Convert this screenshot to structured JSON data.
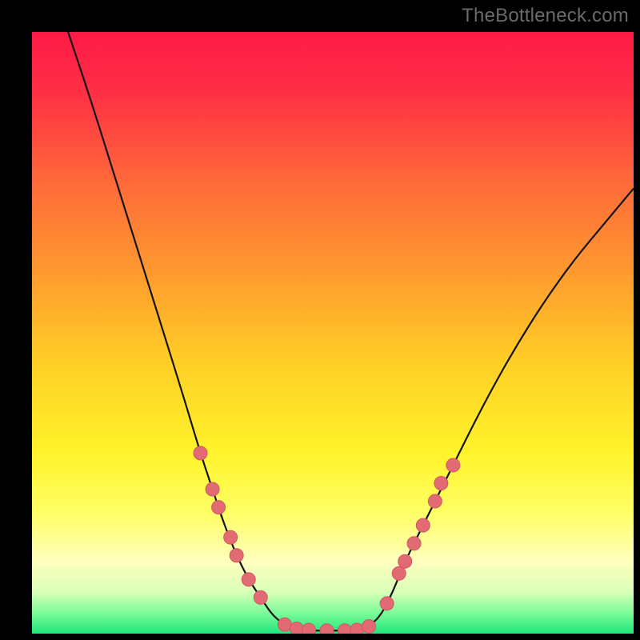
{
  "watermark": {
    "text": "TheBottleneck.com"
  },
  "palette": {
    "black": "#000000",
    "gradient_stops": [
      {
        "offset": 0.0,
        "color": "#ff1a46"
      },
      {
        "offset": 0.1,
        "color": "#ff2f45"
      },
      {
        "offset": 0.25,
        "color": "#ff6a3a"
      },
      {
        "offset": 0.4,
        "color": "#ff9a2f"
      },
      {
        "offset": 0.55,
        "color": "#ffcf26"
      },
      {
        "offset": 0.7,
        "color": "#fff32a"
      },
      {
        "offset": 0.8,
        "color": "#ffff66"
      },
      {
        "offset": 0.88,
        "color": "#ffffbe"
      },
      {
        "offset": 0.93,
        "color": "#d9ffb8"
      },
      {
        "offset": 0.965,
        "color": "#7efc9a"
      },
      {
        "offset": 1.0,
        "color": "#1fe87b"
      }
    ],
    "marker_fill": "#e16a73",
    "marker_stroke": "#d15863",
    "curve_stroke": "#141414"
  },
  "chart_data": {
    "type": "line",
    "title": "",
    "xlabel": "",
    "ylabel": "",
    "xlim": [
      0,
      100
    ],
    "ylim": [
      0,
      100
    ],
    "series": [
      {
        "name": "left-curve",
        "x": [
          6,
          10,
          15,
          20,
          25,
          28,
          30,
          32,
          34,
          36,
          38,
          40,
          42,
          44,
          46
        ],
        "values": [
          100,
          88,
          72,
          56,
          40,
          30,
          24,
          18,
          13,
          9,
          6,
          3,
          1.5,
          0.8,
          0.5
        ]
      },
      {
        "name": "right-curve",
        "x": [
          54,
          56,
          58,
          60,
          62,
          65,
          70,
          75,
          80,
          85,
          90,
          95,
          100
        ],
        "values": [
          0.5,
          1.2,
          3,
          7,
          12,
          18,
          28,
          38,
          47,
          55,
          62,
          68,
          74
        ]
      },
      {
        "name": "plateau",
        "x": [
          44,
          54
        ],
        "values": [
          0.5,
          0.5
        ]
      }
    ],
    "markers": {
      "left": [
        {
          "x": 28,
          "y": 30
        },
        {
          "x": 30,
          "y": 24
        },
        {
          "x": 31,
          "y": 21
        },
        {
          "x": 33,
          "y": 16
        },
        {
          "x": 34,
          "y": 13
        },
        {
          "x": 36,
          "y": 9
        },
        {
          "x": 38,
          "y": 6
        },
        {
          "x": 42,
          "y": 1.5
        },
        {
          "x": 44,
          "y": 0.8
        },
        {
          "x": 46,
          "y": 0.6
        },
        {
          "x": 49,
          "y": 0.5
        },
        {
          "x": 52,
          "y": 0.5
        },
        {
          "x": 54,
          "y": 0.6
        }
      ],
      "right": [
        {
          "x": 56,
          "y": 1.2
        },
        {
          "x": 59,
          "y": 5
        },
        {
          "x": 61,
          "y": 10
        },
        {
          "x": 62,
          "y": 12
        },
        {
          "x": 63.5,
          "y": 15
        },
        {
          "x": 65,
          "y": 18
        },
        {
          "x": 67,
          "y": 22
        },
        {
          "x": 68,
          "y": 25
        },
        {
          "x": 70,
          "y": 28
        }
      ]
    }
  }
}
